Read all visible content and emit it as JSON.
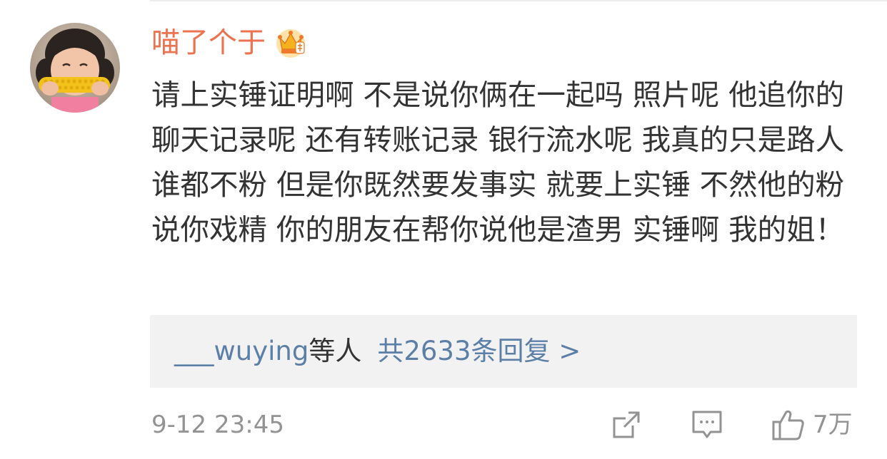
{
  "comment": {
    "username": "喵了个于",
    "badge_icon": "crown-icon",
    "text": "请上实锤证明啊 不是说你俩在一起吗 照片呢 他追你的聊天记录呢 还有转账记录 银行流水呢 我真的只是路人 谁都不粉 但是你既然要发事实 就要上实锤 不然他的粉说你戏精 你的朋友在帮你说他是渣男 实锤啊 我的姐！",
    "timestamp": "9-12 23:45"
  },
  "replies": {
    "users": "___wuying",
    "users_suffix": "等人",
    "count_label": "共2633条回复 >"
  },
  "actions": {
    "share_icon": "share-icon",
    "comment_icon": "comment-icon",
    "like_icon": "thumbs-up-icon",
    "like_count": "7万"
  },
  "colors": {
    "username": "#eb7350",
    "link": "#5b7fa7",
    "text": "#333333",
    "meta": "#939393",
    "reply_bg": "#f2f2f2"
  }
}
